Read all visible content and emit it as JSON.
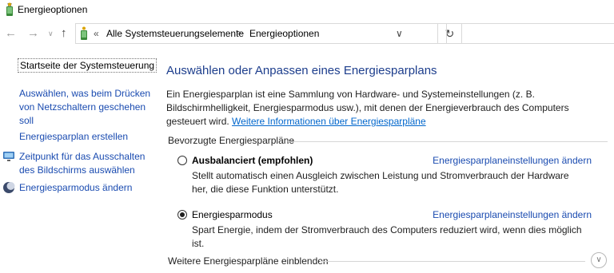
{
  "window": {
    "title": "Energieoptionen",
    "icon": "power-options-icon"
  },
  "nav": {
    "back_icon": "back-arrow-icon",
    "forward_icon": "forward-arrow-icon",
    "recent_icon": "chevron-down-icon",
    "up_icon": "up-arrow-icon"
  },
  "address": {
    "prefix": "«",
    "crumbs": [
      "Alle Systemsteuerungselemente",
      "Energieoptionen"
    ],
    "separator": ">",
    "dropdown_icon": "chevron-down-icon",
    "refresh_icon": "refresh-icon"
  },
  "search": {
    "placeholder": ""
  },
  "sidebar": {
    "home": "Startseite der Systemsteuerung",
    "links": [
      {
        "label": "Auswählen, was beim Drücken von Netzschaltern geschehen soll",
        "icon": ""
      },
      {
        "label": "Energiesparplan erstellen",
        "icon": ""
      },
      {
        "label": "Zeitpunkt für das Ausschalten des Bildschirms auswählen",
        "icon": "display-icon"
      },
      {
        "label": "Energiesparmodus ändern",
        "icon": "moon-icon"
      }
    ]
  },
  "main": {
    "title": "Auswählen oder Anpassen eines Energiesparplans",
    "intro": "Ein Energiesparplan ist eine Sammlung von Hardware- und Systemeinstellungen (z. B. Bildschirmhelligkeit, Energiesparmodus usw.), mit denen der Energieverbrauch des Computers gesteuert wird. ",
    "intro_link": "Weitere Informationen über Energiesparpläne",
    "group_label": "Bevorzugte Energiesparpläne",
    "plans": [
      {
        "name": "Ausbalanciert (empfohlen)",
        "selected": false,
        "settings_link": "Energiesparplaneinstellungen ändern",
        "description": "Stellt automatisch einen Ausgleich zwischen Leistung und Stromverbrauch der Hardware her, die diese Funktion unterstützt."
      },
      {
        "name": "Energiesparmodus",
        "selected": true,
        "settings_link": "Energiesparplaneinstellungen ändern",
        "description": "Spart Energie, indem der Stromverbrauch des Computers reduziert wird, wenn dies möglich ist."
      }
    ],
    "more_plans": "Weitere Energiesparpläne einblenden",
    "more_icon": "chevron-down-circle-icon"
  },
  "colors": {
    "link": "#1a4bb0",
    "title": "#1c3d8c",
    "accent_link": "#0066cc"
  }
}
